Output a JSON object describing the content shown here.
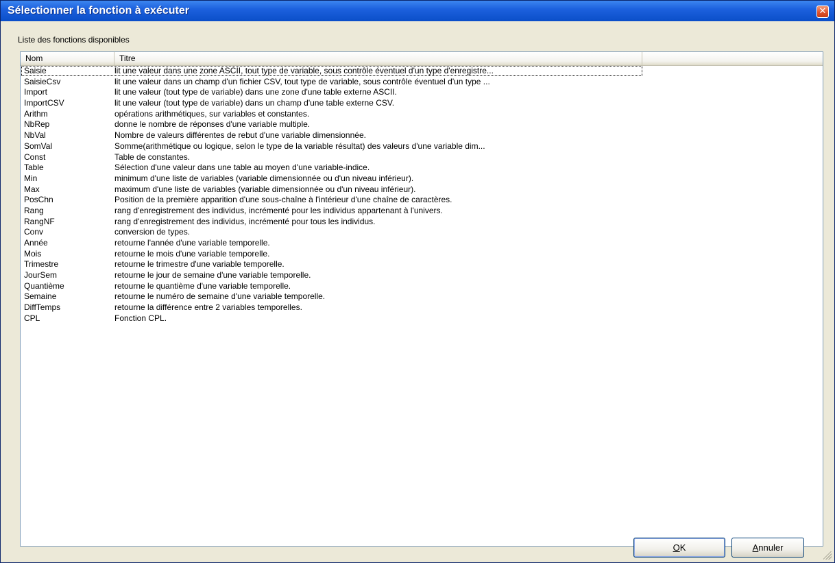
{
  "window": {
    "title": "Sélectionner la fonction à exécuter",
    "close_glyph": "✕"
  },
  "group": {
    "label": "Liste des fonctions disponibles"
  },
  "list": {
    "columns": [
      "Nom",
      "Titre"
    ],
    "rows": [
      {
        "nom": "Saisie",
        "titre": "lit une valeur dans une zone ASCII, tout type de variable, sous contrôle éventuel d'un type d'enregistre..."
      },
      {
        "nom": "SaisieCsv",
        "titre": "lit une valeur dans un champ d'un fichier CSV, tout type de variable, sous contrôle éventuel d'un type ..."
      },
      {
        "nom": "Import",
        "titre": "lit une valeur (tout type de variable) dans une zone d'une table externe ASCII."
      },
      {
        "nom": "ImportCSV",
        "titre": "lit une valeur (tout type de variable) dans un champ d'une table externe CSV."
      },
      {
        "nom": "Arithm",
        "titre": "opérations arithmétiques, sur variables et constantes."
      },
      {
        "nom": "NbRep",
        "titre": "donne le nombre de réponses d'une variable multiple."
      },
      {
        "nom": "NbVal",
        "titre": "Nombre de valeurs différentes de rebut d'une variable dimensionnée."
      },
      {
        "nom": "SomVal",
        "titre": "Somme(arithmétique ou logique, selon le type de la variable résultat) des valeurs d'une variable dim..."
      },
      {
        "nom": "Const",
        "titre": "Table de constantes."
      },
      {
        "nom": "Table",
        "titre": "Sélection d'une valeur dans une table au moyen d'une variable-indice."
      },
      {
        "nom": "Min",
        "titre": "minimum d'une liste de variables (variable dimensionnée ou d'un niveau inférieur)."
      },
      {
        "nom": "Max",
        "titre": "maximum d'une liste de variables (variable dimensionnée ou d'un niveau inférieur)."
      },
      {
        "nom": "PosChn",
        "titre": "Position de la première apparition d'une sous-chaîne à l'intérieur d'une chaîne de caractères."
      },
      {
        "nom": "Rang",
        "titre": "rang d'enregistrement des individus, incrémenté pour les individus appartenant à l'univers."
      },
      {
        "nom": "RangNF",
        "titre": "rang d'enregistrement des individus, incrémenté pour tous les individus."
      },
      {
        "nom": "Conv",
        "titre": "conversion de types."
      },
      {
        "nom": "Année",
        "titre": "retourne l'année d'une variable temporelle."
      },
      {
        "nom": "Mois",
        "titre": "retourne le mois d'une variable temporelle."
      },
      {
        "nom": "Trimestre",
        "titre": "retourne le trimestre d'une variable temporelle."
      },
      {
        "nom": "JourSem",
        "titre": "retourne le jour de semaine d'une variable temporelle."
      },
      {
        "nom": "Quantième",
        "titre": "retourne le quantième d'une variable temporelle."
      },
      {
        "nom": "Semaine",
        "titre": "retourne le numéro de semaine d'une variable temporelle."
      },
      {
        "nom": "DiffTemps",
        "titre": "retourne la différence entre 2 variables temporelles."
      },
      {
        "nom": "CPL",
        "titre": "Fonction CPL."
      }
    ]
  },
  "buttons": {
    "ok": {
      "accel": "O",
      "rest": "K"
    },
    "cancel": {
      "accel": "A",
      "rest": "nnuler"
    }
  },
  "colors": {
    "title_bar": "#1d61de",
    "dialog_bg": "#ece9d8",
    "close_button": "#e3542e",
    "list_border": "#7f9db9"
  }
}
